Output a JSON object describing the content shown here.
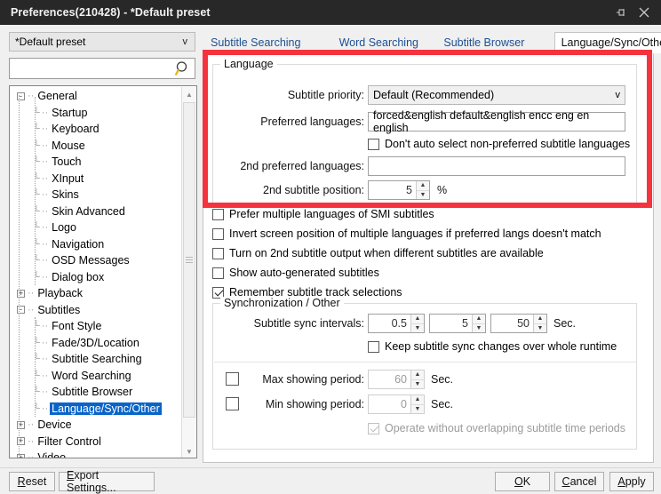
{
  "window": {
    "title": "Preferences(210428) - *Default preset",
    "pin_icon": "pin-icon",
    "close_icon": "close-icon"
  },
  "preset": {
    "value": "*Default preset",
    "chevron": "v"
  },
  "search": {
    "value": "",
    "placeholder": "",
    "icon": "search-icon"
  },
  "tree": {
    "items": [
      {
        "label": "General",
        "depth": 0,
        "expander": "-",
        "selected": false
      },
      {
        "label": "Startup",
        "depth": 1,
        "expander": null,
        "selected": false
      },
      {
        "label": "Keyboard",
        "depth": 1,
        "expander": null,
        "selected": false
      },
      {
        "label": "Mouse",
        "depth": 1,
        "expander": null,
        "selected": false
      },
      {
        "label": "Touch",
        "depth": 1,
        "expander": null,
        "selected": false
      },
      {
        "label": "XInput",
        "depth": 1,
        "expander": null,
        "selected": false
      },
      {
        "label": "Skins",
        "depth": 1,
        "expander": null,
        "selected": false
      },
      {
        "label": "Skin Advanced",
        "depth": 1,
        "expander": null,
        "selected": false
      },
      {
        "label": "Logo",
        "depth": 1,
        "expander": null,
        "selected": false
      },
      {
        "label": "Navigation",
        "depth": 1,
        "expander": null,
        "selected": false
      },
      {
        "label": "OSD Messages",
        "depth": 1,
        "expander": null,
        "selected": false
      },
      {
        "label": "Dialog box",
        "depth": 1,
        "expander": null,
        "selected": false
      },
      {
        "label": "Playback",
        "depth": 0,
        "expander": "+",
        "selected": false
      },
      {
        "label": "Subtitles",
        "depth": 0,
        "expander": "-",
        "selected": false
      },
      {
        "label": "Font Style",
        "depth": 1,
        "expander": null,
        "selected": false
      },
      {
        "label": "Fade/3D/Location",
        "depth": 1,
        "expander": null,
        "selected": false
      },
      {
        "label": "Subtitle Searching",
        "depth": 1,
        "expander": null,
        "selected": false
      },
      {
        "label": "Word Searching",
        "depth": 1,
        "expander": null,
        "selected": false
      },
      {
        "label": "Subtitle Browser",
        "depth": 1,
        "expander": null,
        "selected": false
      },
      {
        "label": "Language/Sync/Other",
        "depth": 1,
        "expander": null,
        "selected": true
      },
      {
        "label": "Device",
        "depth": 0,
        "expander": "+",
        "selected": false
      },
      {
        "label": "Filter Control",
        "depth": 0,
        "expander": "+",
        "selected": false
      },
      {
        "label": "Video",
        "depth": 0,
        "expander": "+",
        "selected": false
      }
    ]
  },
  "tabs": [
    {
      "label": "Subtitle Searching",
      "active": false
    },
    {
      "label": "Word Searching",
      "active": false
    },
    {
      "label": "Subtitle Browser",
      "active": false
    },
    {
      "label": "Language/Sync/Other",
      "active": true
    }
  ],
  "tabnav": {
    "prev": "◀",
    "next": "▶"
  },
  "language_group": {
    "legend": "Language",
    "subtitle_priority_label": "Subtitle priority:",
    "subtitle_priority_value": "Default (Recommended)",
    "subtitle_priority_chevron": "v",
    "preferred_languages_label": "Preferred languages:",
    "preferred_languages_value": "forced&english default&english encc eng en english",
    "dont_auto_select_label": "Don't auto select non-preferred subtitle languages",
    "dont_auto_select_checked": false,
    "second_preferred_label": "2nd preferred languages:",
    "second_preferred_value": "",
    "second_position_label": "2nd subtitle position:",
    "second_position_value": "5",
    "second_position_unit": "%"
  },
  "checkbox_list": [
    {
      "label": "Prefer multiple languages of SMI subtitles",
      "checked": false
    },
    {
      "label": "Invert screen position of multiple languages if preferred langs doesn't match",
      "checked": false
    },
    {
      "label": "Turn on 2nd subtitle output when different subtitles are available",
      "checked": false
    },
    {
      "label": "Show auto-generated subtitles",
      "checked": false
    },
    {
      "label": "Remember subtitle track selections",
      "checked": true
    }
  ],
  "sync_group": {
    "legend": "Synchronization / Other",
    "sync_intervals_label": "Subtitle sync intervals:",
    "sync_intervals": [
      "0.5",
      "5",
      "50"
    ],
    "sync_intervals_unit": "Sec.",
    "keep_sync_label": "Keep subtitle sync changes over whole runtime",
    "keep_sync_checked": false,
    "max_period_label": "Max showing period:",
    "max_period_value": "60",
    "max_period_unit": "Sec.",
    "max_period_checked": false,
    "min_period_label": "Min showing period:",
    "min_period_value": "0",
    "min_period_unit": "Sec.",
    "min_period_checked": false,
    "no_overlap_label": "Operate without overlapping subtitle time periods",
    "no_overlap_checked": true
  },
  "footer": {
    "reset": "Reset",
    "reset_accel": "R",
    "export": "Export Settings...",
    "export_accel": "E",
    "ok": "OK",
    "ok_accel": "O",
    "cancel": "Cancel",
    "cancel_accel": "C",
    "apply": "Apply",
    "apply_accel": "A"
  },
  "colors": {
    "titlebar_bg": "#282828",
    "highlight_red": "#f5333f",
    "tab_link": "#1c4f91",
    "selection_blue": "#0a64c8"
  }
}
